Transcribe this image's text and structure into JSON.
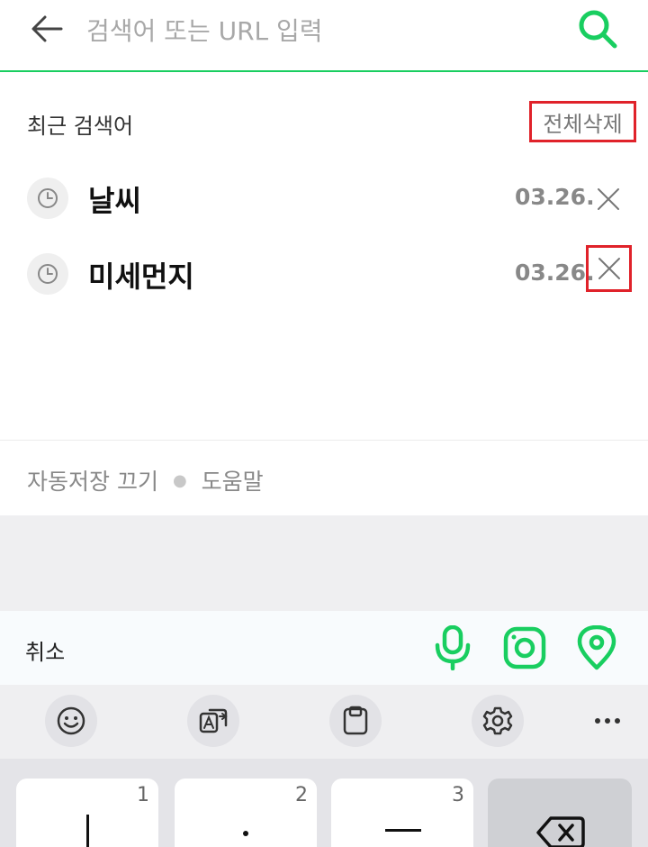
{
  "search": {
    "placeholder": "검색어 또는 URL 입력"
  },
  "recent": {
    "title": "최근 검색어",
    "delete_all_label": "전체삭제",
    "items": [
      {
        "term": "날씨",
        "date": "03.26."
      },
      {
        "term": "미세먼지",
        "date": "03.26."
      }
    ]
  },
  "footer": {
    "autosave_label": "자동저장 끄기",
    "help_label": "도움말"
  },
  "action_bar": {
    "cancel_label": "취소",
    "icons": [
      "microphone-icon",
      "camera-lens-icon",
      "location-pin-icon"
    ]
  },
  "keyboard": {
    "toolbar_icons": [
      "emoji-icon",
      "translate-icon",
      "clipboard-icon",
      "settings-icon",
      "more-icon"
    ],
    "keys": [
      {
        "number": "1",
        "glyph": "ㅣ"
      },
      {
        "number": "2",
        "glyph": "·"
      },
      {
        "number": "3",
        "glyph": "ㅡ"
      }
    ]
  },
  "colors": {
    "accent": "#19ce60",
    "highlight": "#e0222a"
  }
}
